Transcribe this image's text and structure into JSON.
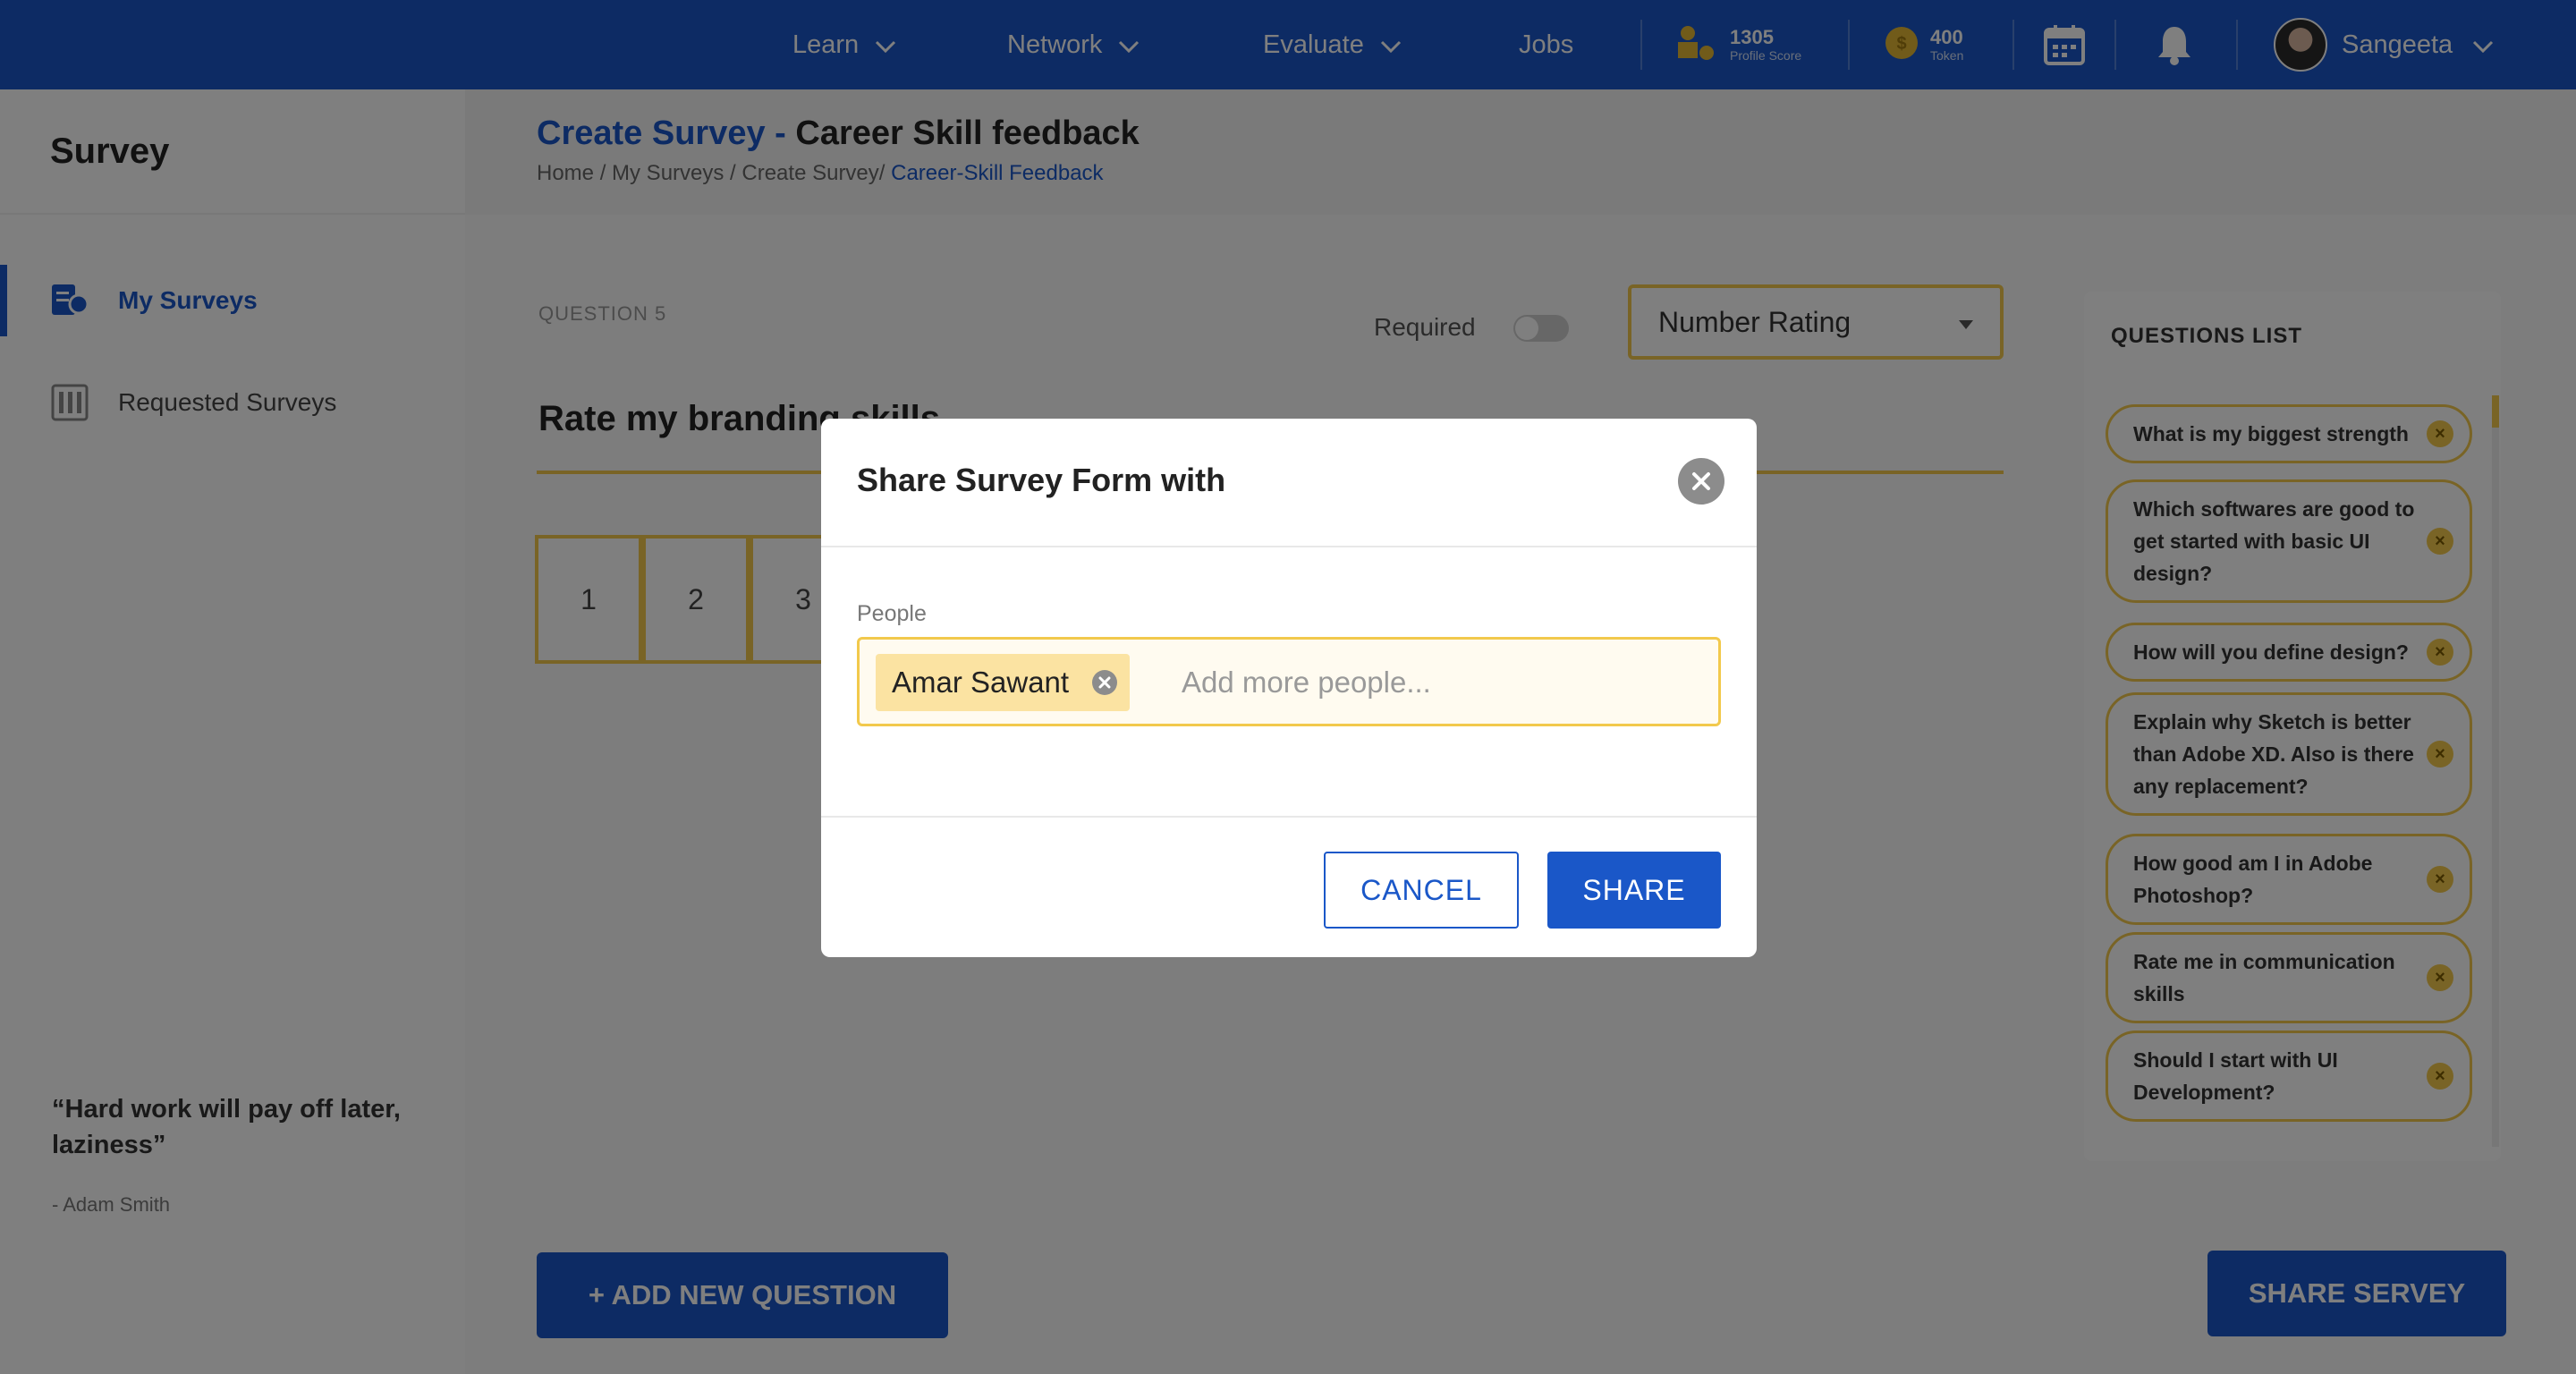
{
  "nav": {
    "items": [
      {
        "label": "Learn"
      },
      {
        "label": "Network"
      },
      {
        "label": "Evaluate"
      },
      {
        "label": "Jobs"
      }
    ],
    "profile_score": {
      "value": "1305",
      "label": "Profile Score"
    },
    "tokens": {
      "value": "400",
      "label": "Token"
    },
    "user_name": "Sangeeta",
    "icons": [
      "chevron-down-icon",
      "trophy-icon",
      "coin-icon",
      "calendar-icon",
      "bell-icon",
      "avatar"
    ]
  },
  "sidebar": {
    "title": "Survey",
    "items": [
      {
        "label": "My Surveys",
        "active": true,
        "icon": "survey-icon"
      },
      {
        "label": "Requested Surveys",
        "active": false,
        "icon": "document-icon"
      }
    ],
    "quote": "“Hard work will pay off later, laziness”",
    "quote_author": "- Adam Smith"
  },
  "header": {
    "title_prefix": "Create Survey - ",
    "title_main": "Career Skill feedback",
    "breadcrumb_path": "Home / My Surveys / Create Survey/ ",
    "breadcrumb_current": "Career-Skill Feedback"
  },
  "question": {
    "number_label": "QUESTION 5",
    "required_label": "Required",
    "required_on": false,
    "type_select": "Number Rating",
    "title": "Rate my branding skills",
    "rating_values": [
      "1",
      "2",
      "3"
    ]
  },
  "questions_list": {
    "title": "QUESTIONS LIST",
    "items": [
      "What is my biggest strength",
      "Which softwares are good to get started with basic UI design?",
      "How will you define design?",
      "Explain why Sketch is better than Adobe XD. Also is there any replacement?",
      "How good am I in Adobe Photoshop?",
      "Rate me in communication skills",
      "Should I start with UI Development?"
    ]
  },
  "footer": {
    "add_question_label": "+ ADD NEW QUESTION",
    "share_survey_label": "SHARE SERVEY"
  },
  "modal": {
    "title": "Share Survey Form with",
    "people_label": "People",
    "chip_name": "Amar Sawant",
    "input_placeholder": "Add more people...",
    "cancel_label": "CANCEL",
    "share_label": "SHARE"
  },
  "colors": {
    "primary": "#1a57c8",
    "accent": "#f2c94c",
    "chip_bg": "#fbe3a2"
  }
}
